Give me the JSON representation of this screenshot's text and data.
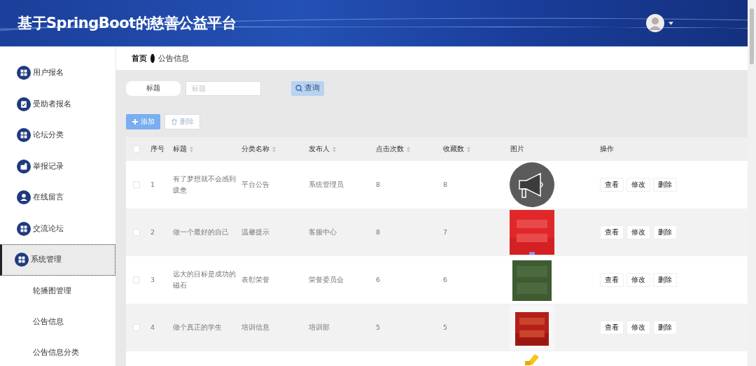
{
  "header": {
    "title": "基于SpringBoot的慈善公益平台"
  },
  "sidebar": {
    "items": [
      {
        "label": "用户报名",
        "selected": false
      },
      {
        "label": "受助者报名",
        "selected": false
      },
      {
        "label": "论坛分类",
        "selected": false
      },
      {
        "label": "举报记录",
        "selected": false
      },
      {
        "label": "在线留言",
        "selected": false
      },
      {
        "label": "交流论坛",
        "selected": false
      },
      {
        "label": "系统管理",
        "selected": true,
        "children": [
          {
            "label": "轮播图管理"
          },
          {
            "label": "公告信息"
          },
          {
            "label": "公告信息分类"
          }
        ]
      }
    ]
  },
  "breadcrumb": [
    "首页",
    "公告信息"
  ],
  "search": {
    "label": "标题",
    "placeholder": "标题",
    "button": "查询"
  },
  "actions": [
    "添加",
    "删除"
  ],
  "table": {
    "header_checked": false,
    "columns": [
      {
        "label": "序号",
        "sortable": false
      },
      {
        "label": "标题",
        "sortable": true
      },
      {
        "label": "分类名称",
        "sortable": true
      },
      {
        "label": "发布人",
        "sortable": true
      },
      {
        "label": "点击次数",
        "sortable": true
      },
      {
        "label": "收藏数",
        "sortable": true
      },
      {
        "label": "图片",
        "sortable": false
      },
      {
        "label": "操作",
        "sortable": false
      }
    ],
    "rows": [
      {
        "checked": false,
        "no": "1",
        "title": "有了梦想就不会感到疲惫",
        "category": "平台公告",
        "publisher": "系统管理员",
        "clicks": "8",
        "favorites": "8",
        "ops": [
          "查看",
          "修改",
          "删除"
        ]
      },
      {
        "checked": false,
        "no": "2",
        "title": "做一个最好的自己",
        "category": "温馨提示",
        "publisher": "客服中心",
        "clicks": "8",
        "favorites": "7",
        "ops": [
          "查看",
          "修改",
          "删除"
        ]
      },
      {
        "checked": false,
        "no": "3",
        "title": "远大的目标是成功的磁石",
        "category": "表彰荣誉",
        "publisher": "荣誉委员会",
        "clicks": "6",
        "favorites": "6",
        "ops": [
          "查看",
          "修改",
          "删除"
        ]
      },
      {
        "checked": false,
        "no": "4",
        "title": "做个真正的学生",
        "category": "培训信息",
        "publisher": "培训部",
        "clicks": "5",
        "favorites": "5",
        "ops": [
          "查看",
          "修改",
          "删除"
        ]
      }
    ]
  }
}
